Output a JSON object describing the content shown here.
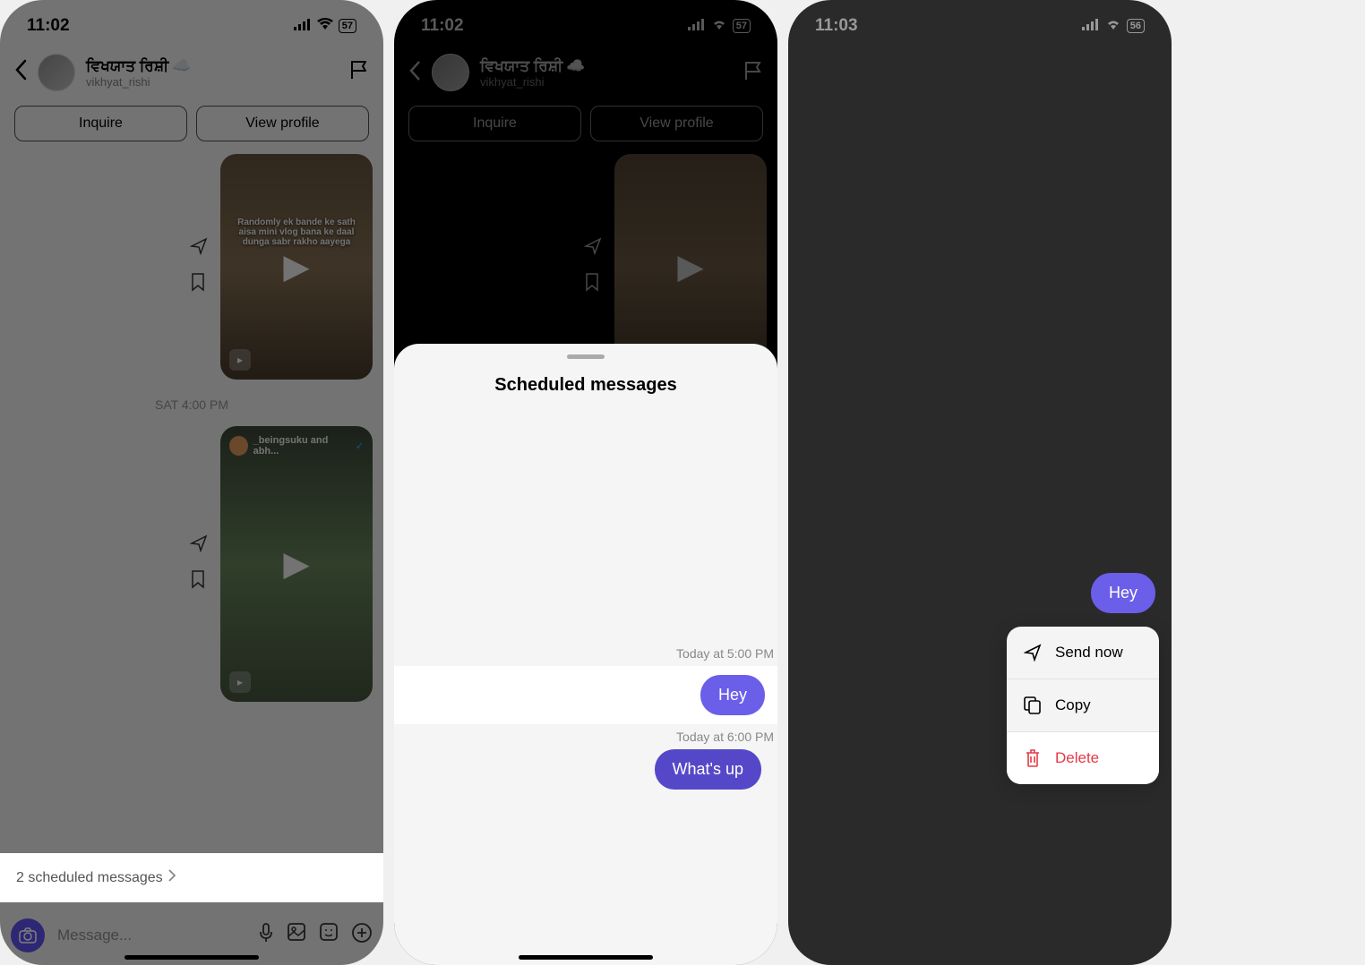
{
  "phone1": {
    "time": "11:02",
    "battery": "57",
    "header": {
      "name": "ਵਿਖਯਾਤ ਰਿਸ਼ੀ",
      "emoji": "☁️",
      "username": "vikhyat_rishi"
    },
    "actions": {
      "inquire": "Inquire",
      "view_profile": "View profile"
    },
    "reel1_text": "Randomly ek bande ke sath aisa mini vlog bana ke daal dunga sabr rakho aayega",
    "timestamp": "SAT 4:00 PM",
    "reel2_user": "_beingsuku and abh...",
    "scheduled_text": "2 scheduled messages",
    "compose_placeholder": "Message..."
  },
  "phone2": {
    "time": "11:02",
    "battery": "57",
    "header": {
      "name": "ਵਿਖਯਾਤ ਰਿਸ਼ੀ",
      "emoji": "☁️",
      "username": "vikhyat_rishi"
    },
    "actions": {
      "inquire": "Inquire",
      "view_profile": "View profile"
    },
    "sheet_title": "Scheduled messages",
    "items": [
      {
        "time": "Today at 5:00 PM",
        "text": "Hey",
        "highlighted": true
      },
      {
        "time": "Today at 6:00 PM",
        "text": "What's up",
        "highlighted": false
      }
    ]
  },
  "phone3": {
    "time": "11:03",
    "battery": "56",
    "bubble": "Hey",
    "menu": {
      "send_now": "Send now",
      "copy": "Copy",
      "delete": "Delete"
    }
  }
}
